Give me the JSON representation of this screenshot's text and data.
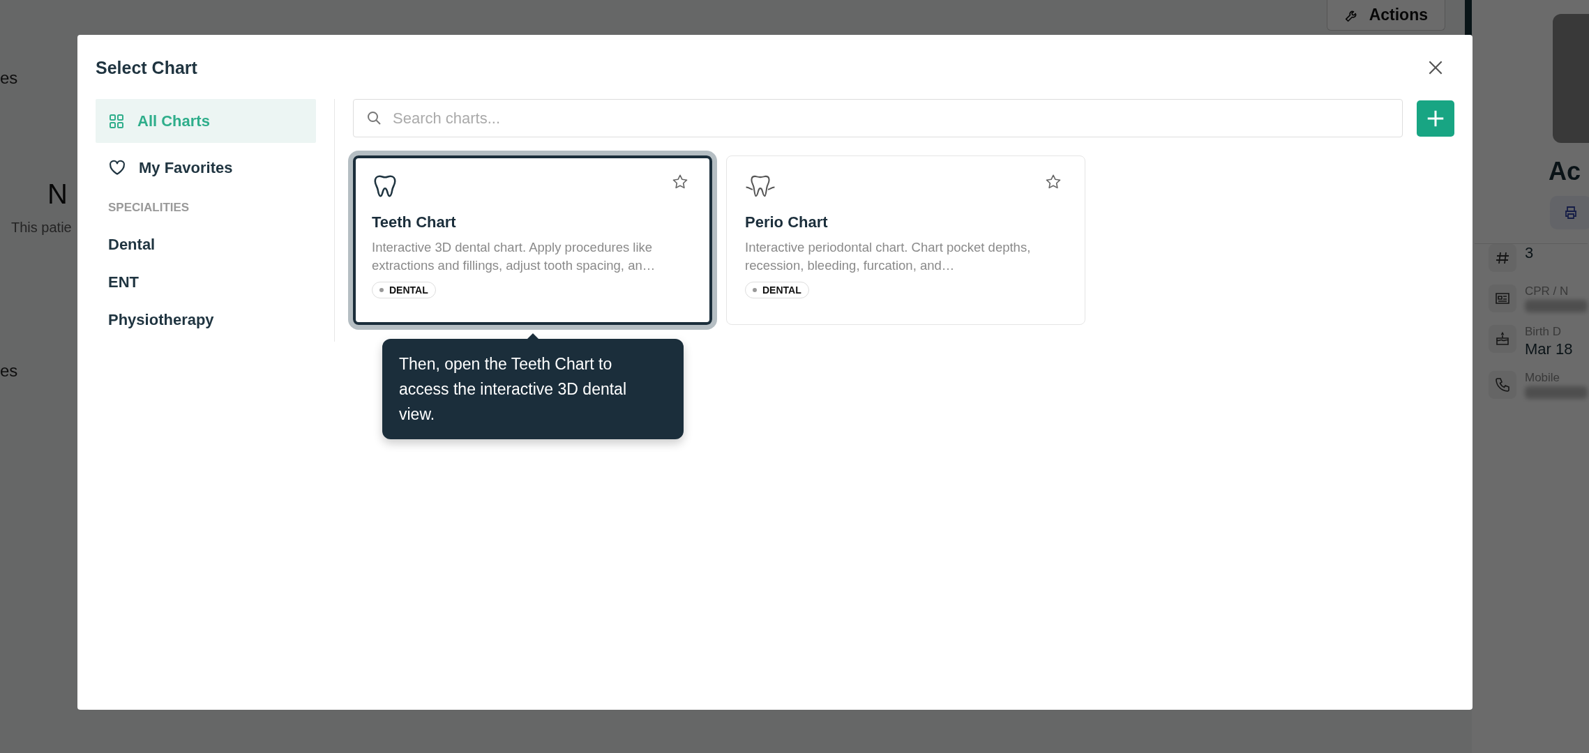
{
  "background": {
    "actions_button": "Actions",
    "left_fragments": [
      {
        "kind": "label",
        "text": "es"
      },
      {
        "kind": "heading",
        "text": "N"
      },
      {
        "kind": "note",
        "text": "This patie"
      },
      {
        "kind": "label",
        "text": "es"
      }
    ],
    "profile": {
      "name": "Ac",
      "fields": [
        {
          "kind": "number",
          "value": "3"
        },
        {
          "kind": "id",
          "label": "CPR / N"
        },
        {
          "kind": "birthday",
          "label": "Birth D",
          "value": "Mar 18"
        },
        {
          "kind": "phone",
          "label": "Mobile"
        }
      ]
    }
  },
  "modal": {
    "title": "Select Chart",
    "nav": [
      {
        "kind": "all",
        "label": "All Charts",
        "selected": true
      },
      {
        "kind": "favorites",
        "label": "My Favorites",
        "selected": false
      }
    ],
    "section_heading": "SPECIALITIES",
    "specialities": [
      {
        "label": "Dental",
        "selected": false
      },
      {
        "label": "ENT",
        "selected": false
      },
      {
        "label": "Physiotherapy",
        "selected": false
      }
    ],
    "search": {
      "placeholder": "Search charts..."
    },
    "charts": [
      {
        "kind": "tooth",
        "title": "Teeth Chart",
        "description": "Interactive 3D dental chart. Apply procedures like extractions and fillings, adjust tooth spacing, an…",
        "tag": "DENTAL",
        "highlighted": true,
        "favorite": false
      },
      {
        "kind": "tooth_gum",
        "title": "Perio Chart",
        "description": "Interactive periodontal chart. Chart pocket depths, recession, bleeding, furcation, and…",
        "tag": "DENTAL",
        "highlighted": false,
        "favorite": false
      }
    ],
    "tooltip": {
      "text": "Then, open the Teeth Chart to access the interactive 3D dental view."
    }
  }
}
